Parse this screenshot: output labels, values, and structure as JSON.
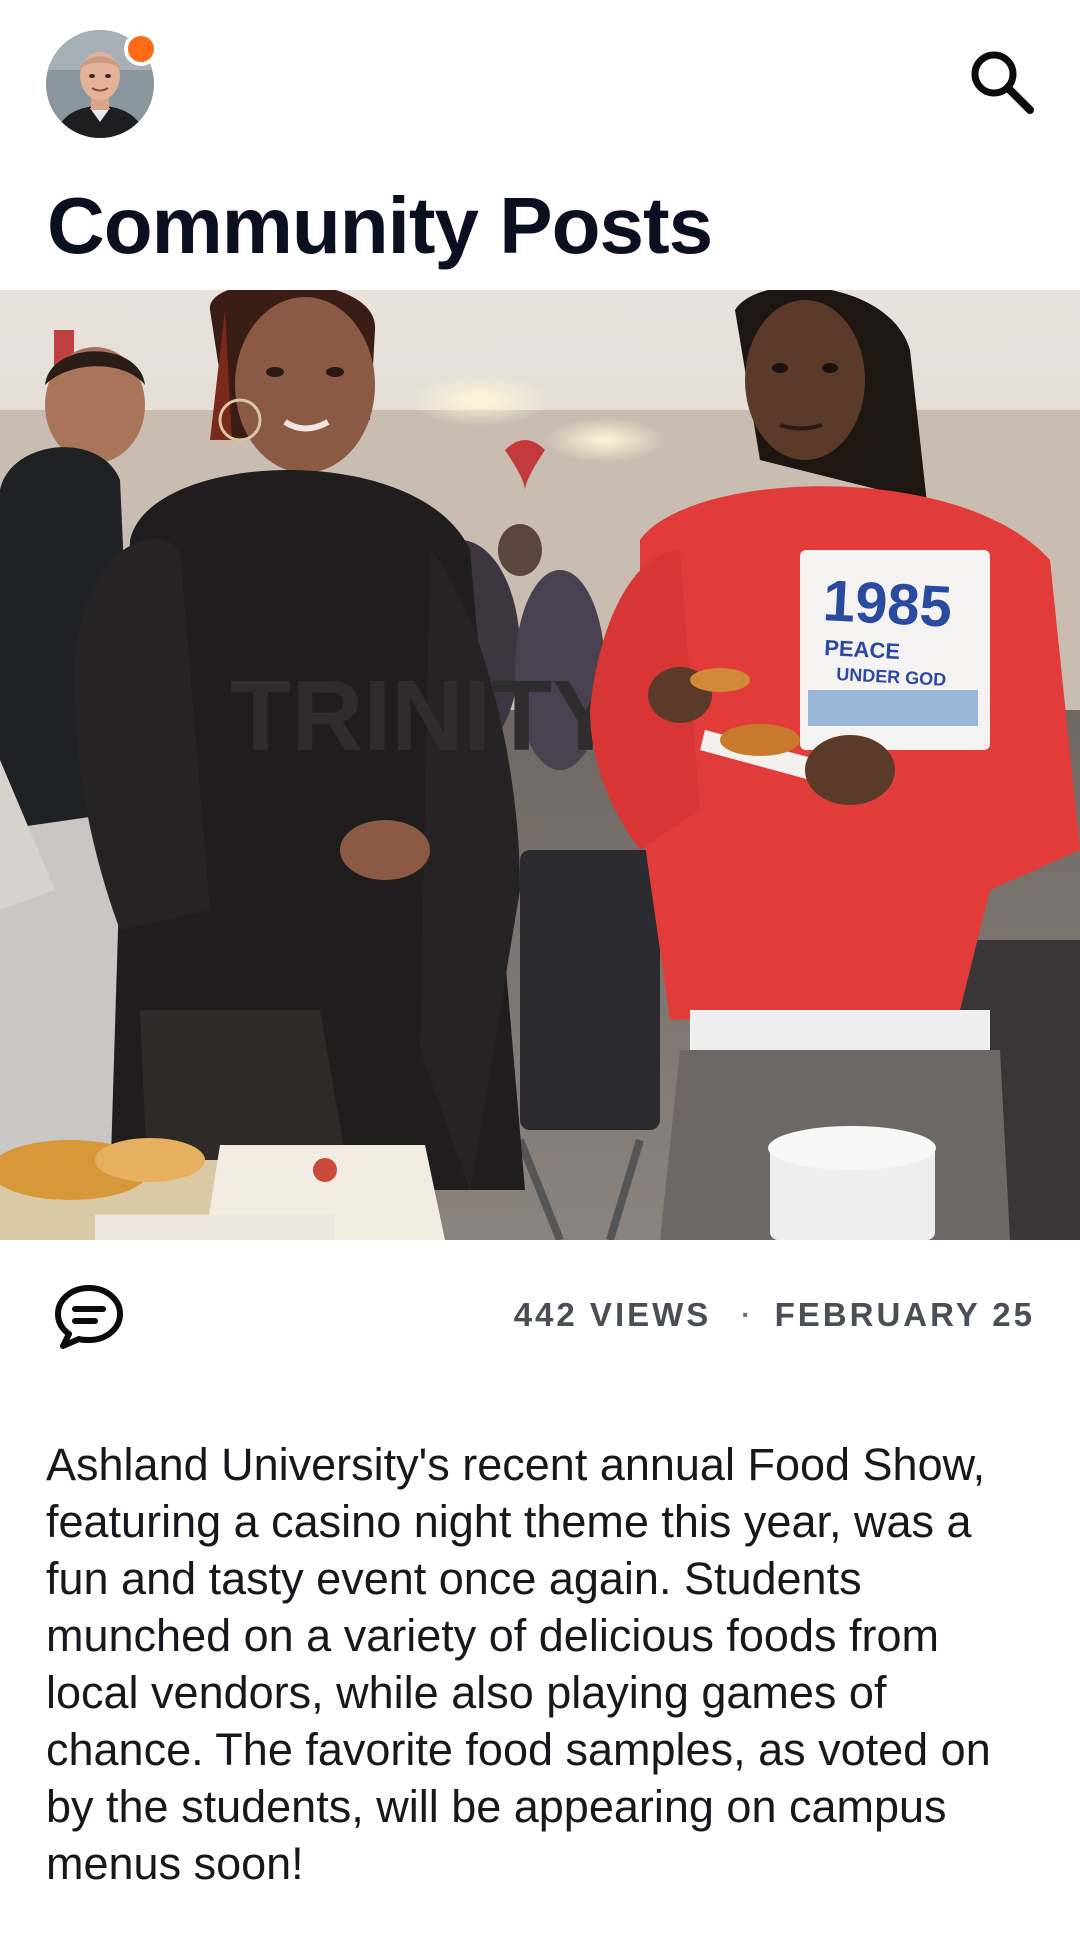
{
  "header": {
    "avatar_icon": "user-avatar",
    "notification_color": "#ff6a14",
    "search_icon": "search-icon"
  },
  "page": {
    "title": "Community Posts"
  },
  "post": {
    "image_icon": "event-photo",
    "comment_icon": "comment-icon",
    "views": "442 VIEWS",
    "separator": "·",
    "date": "FEBRUARY 25",
    "body": "Ashland University's recent annual Food Show, featuring a casino night theme this year, was a fun and tasty event once again. Students munched on a variety of delicious foods from local vendors, while also playing games of chance. The favorite food samples, as voted on by the students, will be appearing on campus menus soon!",
    "photo_text": {
      "hoodie_year": "1985",
      "hoodie_line1": "PEACE",
      "hoodie_line2": "UNDER GOD",
      "sweatshirt": "TRINITY"
    }
  }
}
